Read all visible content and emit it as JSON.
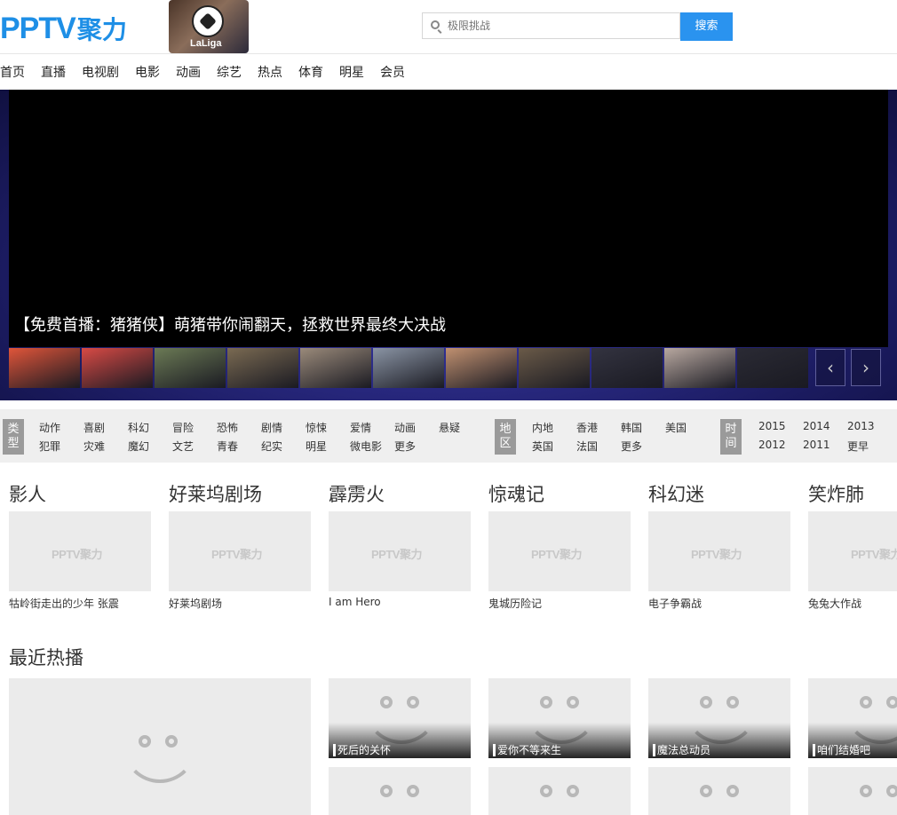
{
  "header": {
    "logo_text": "PPTV",
    "logo_sub": "聚力",
    "promo_badge": "LaLiga",
    "search_placeholder": "极限挑战",
    "search_button": "搜索"
  },
  "nav": [
    "首页",
    "直播",
    "电视剧",
    "电影",
    "动画",
    "综艺",
    "热点",
    "体育",
    "明星",
    "会员"
  ],
  "hero": {
    "caption": "【免费首播：猪猪侠】萌猪带你闹翻天，拯救世界最终大决战",
    "thumb_colors": [
      "#e0553a",
      "#d84a45",
      "#6b7a55",
      "#7a6a52",
      "#9a8a7a",
      "#8a94a4",
      "#c09070",
      "#6a5a48",
      "#333340",
      "#b8a8a0",
      "#2a2a34"
    ],
    "prev_arrow": "‹",
    "next_arrow": "›",
    "colors": {
      "accent": "#2a93ef",
      "logo": "#1e8fe6"
    }
  },
  "filters": {
    "type": {
      "tag": "类型",
      "row1": [
        "动作",
        "喜剧",
        "科幻",
        "冒险",
        "恐怖",
        "剧情",
        "惊悚",
        "爱情",
        "动画",
        "悬疑"
      ],
      "row2": [
        "犯罪",
        "灾难",
        "魔幻",
        "文艺",
        "青春",
        "纪实",
        "明星",
        "微电影",
        "更多"
      ]
    },
    "region": {
      "tag": "地区",
      "row1": [
        "内地",
        "香港",
        "韩国",
        "美国"
      ],
      "row2": [
        "英国",
        "法国",
        "更多"
      ]
    },
    "time": {
      "tag": "时间",
      "row1": [
        "2015",
        "2014",
        "2013"
      ],
      "row2": [
        "2012",
        "2011",
        "更早"
      ]
    }
  },
  "categories": [
    {
      "title": "影人",
      "caption": "牯岭街走出的少年 张震"
    },
    {
      "title": "好莱坞剧场",
      "caption": "好莱坞剧场"
    },
    {
      "title": "霹雳火",
      "caption": "I am Hero"
    },
    {
      "title": "惊魂记",
      "caption": "鬼城历险记"
    },
    {
      "title": "科幻迷",
      "caption": "电子争霸战"
    },
    {
      "title": "笑炸肺",
      "caption": "兔兔大作战"
    }
  ],
  "placeholder_logo": "PPTV聚力",
  "recent": {
    "title": "最近热播",
    "tiles": [
      "死后的关怀",
      "爱你不等来生",
      "魔法总动员",
      "咱们结婚吧"
    ]
  }
}
